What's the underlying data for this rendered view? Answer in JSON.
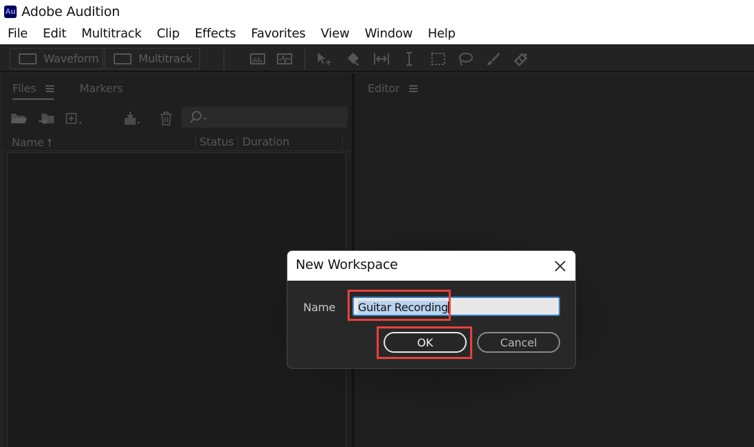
{
  "app": {
    "logo_text": "Au",
    "title": "Adobe Audition"
  },
  "menu": [
    "File",
    "Edit",
    "Multitrack",
    "Clip",
    "Effects",
    "Favorites",
    "View",
    "Window",
    "Help"
  ],
  "toolbar": {
    "waveform_label": "Waveform",
    "multitrack_label": "Multitrack",
    "tools": [
      "spectral-frequency-icon",
      "spectral-pitch-icon",
      "move-tool-icon",
      "razor-tool-icon",
      "slip-tool-icon",
      "time-selection-icon",
      "marquee-selection-icon",
      "lasso-selection-icon",
      "paintbrush-selection-icon",
      "spot-healing-icon"
    ]
  },
  "files_panel": {
    "tab_files": "Files",
    "tab_markers": "Markers",
    "columns": {
      "name": "Name",
      "status": "Status",
      "duration": "Duration"
    }
  },
  "editor_panel": {
    "tab_editor": "Editor"
  },
  "dialog": {
    "title": "New Workspace",
    "name_label": "Name",
    "name_value": "Guitar Recording",
    "ok_label": "OK",
    "cancel_label": "Cancel"
  },
  "colors": {
    "highlight": "#e8413a",
    "input_focus": "#3b82c9",
    "logo_bg": "#00005b",
    "logo_text": "#9999ff"
  }
}
